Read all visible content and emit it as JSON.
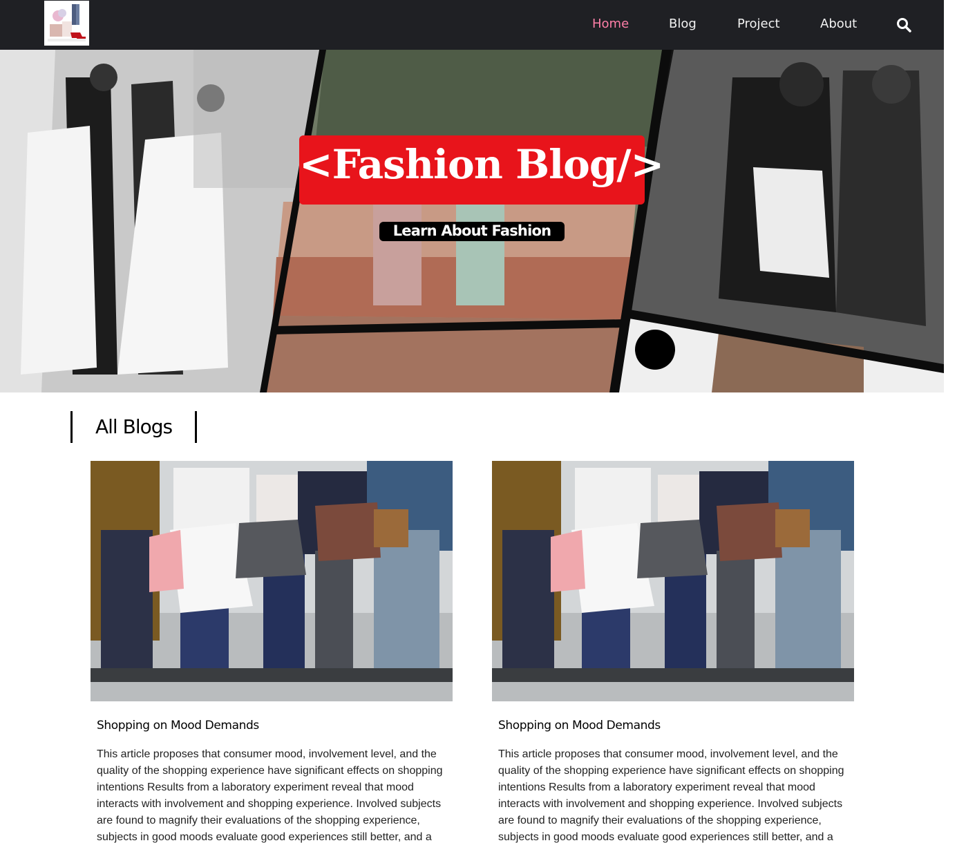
{
  "nav": {
    "logo_alt": "fashion logo",
    "links": [
      {
        "label": "Home",
        "active": true
      },
      {
        "label": "Blog",
        "active": false
      },
      {
        "label": "Project",
        "active": false
      },
      {
        "label": "About",
        "active": false
      }
    ],
    "search_icon": "search-icon"
  },
  "hero": {
    "title": "<Fashion Blog/>",
    "subtitle": "Learn About Fashion"
  },
  "section": {
    "heading": "All Blogs"
  },
  "posts": [
    {
      "title": "Shopping on Mood Demands",
      "excerpt": "This article proposes that consumer mood, involvement level, and the quality of the shopping experience have significant effects on shopping intentions Results from a laboratory experiment reveal that mood interacts with involvement and shopping experience. Involved subjects are found to magnify their evaluations of the shopping experience, subjects in good moods evaluate good experiences still better, and a"
    },
    {
      "title": "Shopping on Mood Demands",
      "excerpt": "This article proposes that consumer mood, involvement level, and the quality of the shopping experience have significant effects on shopping intentions Results from a laboratory experiment reveal that mood interacts with involvement and shopping experience. Involved subjects are found to magnify their evaluations of the shopping experience, subjects in good moods evaluate good experiences still better, and a"
    }
  ],
  "colors": {
    "nav_bg": "#1f2024",
    "nav_active": "#ff7fa8",
    "hero_title_bg": "#e8141b"
  }
}
